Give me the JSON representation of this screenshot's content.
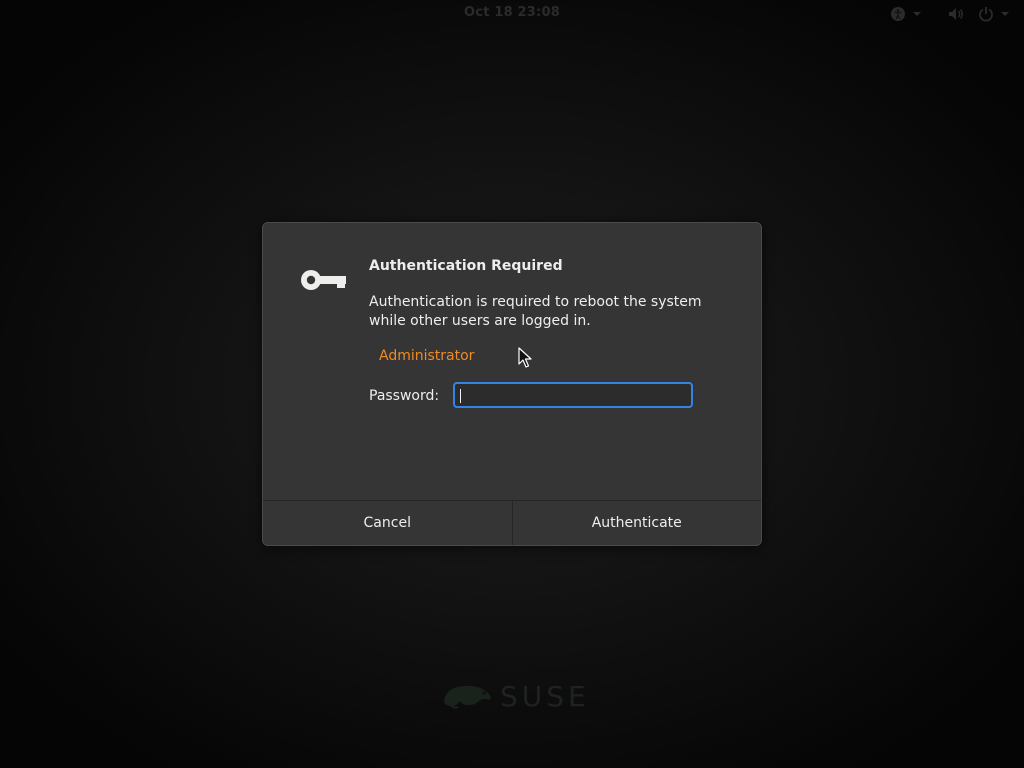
{
  "topbar": {
    "clock": "Oct 18  23:08",
    "icons": [
      "accessibility-icon",
      "volume-icon",
      "power-icon"
    ]
  },
  "dialog": {
    "title": "Authentication Required",
    "description": "Authentication is required to reboot the system while other users are logged in.",
    "user": "Administrator",
    "password_label": "Password:",
    "password_value": "",
    "cancel_label": "Cancel",
    "authenticate_label": "Authenticate",
    "user_color": "#f08a24",
    "focus_color": "#3584e4"
  },
  "branding": {
    "logo_text": "SUSE"
  }
}
